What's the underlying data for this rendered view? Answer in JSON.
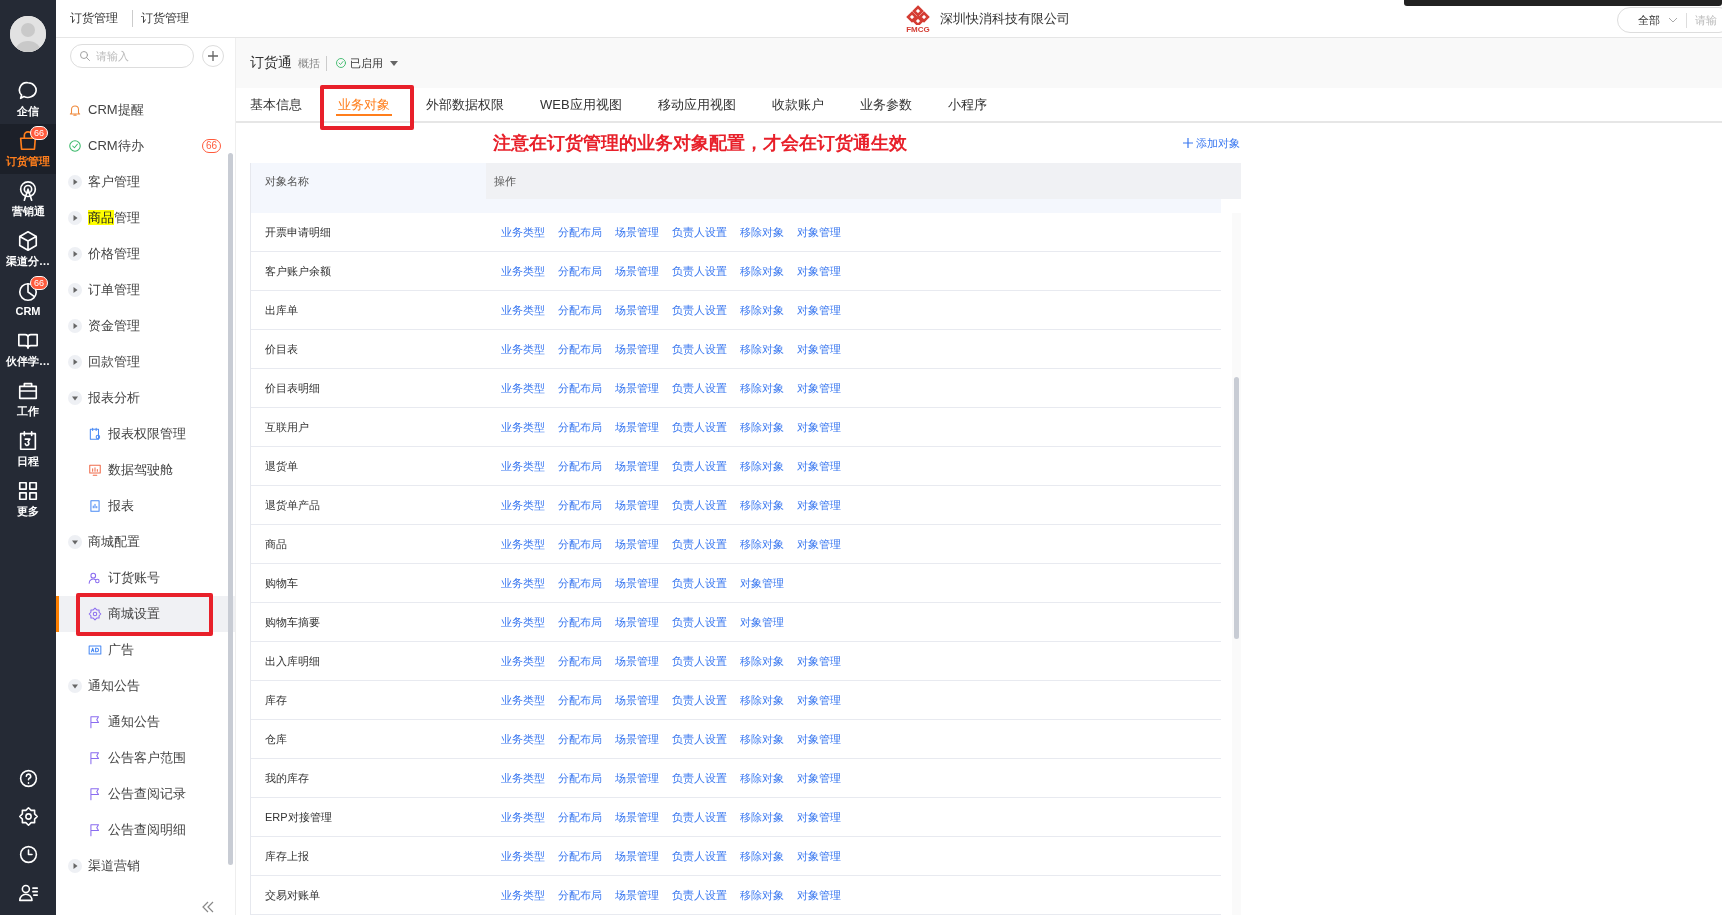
{
  "rail": {
    "items": [
      {
        "label": "企信",
        "selected": false
      },
      {
        "label": "订货管理",
        "selected": true,
        "badge": "66"
      },
      {
        "label": "营销通",
        "selected": false
      },
      {
        "label": "渠道分…",
        "selected": false
      },
      {
        "label": "CRM",
        "selected": false,
        "badge": "66"
      },
      {
        "label": "伙伴学…",
        "selected": false
      },
      {
        "label": "工作",
        "selected": false
      },
      {
        "label": "日程",
        "selected": false
      },
      {
        "label": "更多",
        "selected": false
      }
    ]
  },
  "topbar": {
    "breadcrumb": [
      "订货管理",
      "订货管理"
    ],
    "logo_text": "FMCG",
    "company": "深圳快消科技有限公司",
    "search_scope": "全部",
    "search_placeholder": "请输"
  },
  "sidebar": {
    "search_placeholder": "请输入",
    "items": [
      {
        "label": "CRM提醒",
        "selected": false
      },
      {
        "label": "CRM待办",
        "selected": false,
        "badge": "66"
      },
      {
        "label": "客户管理",
        "expanded": false
      },
      {
        "label_highlight": "商品",
        "label": "管理",
        "expanded": false
      },
      {
        "label": "价格管理",
        "expanded": false
      },
      {
        "label": "订单管理",
        "expanded": false
      },
      {
        "label": "资金管理",
        "expanded": false
      },
      {
        "label": "回款管理",
        "expanded": false
      },
      {
        "label": "报表分析",
        "expanded": true,
        "children": [
          {
            "label": "报表权限管理",
            "selected": false
          },
          {
            "label": "数据驾驶舱",
            "selected": false
          },
          {
            "label": "报表",
            "selected": false
          }
        ]
      },
      {
        "label": "商城配置",
        "expanded": true,
        "children": [
          {
            "label": "订货账号",
            "selected": false
          },
          {
            "label": "商城设置",
            "selected": true,
            "annotated": true
          },
          {
            "label": "广告",
            "selected": false
          }
        ]
      },
      {
        "label": "通知公告",
        "expanded": true,
        "children": [
          {
            "label": "通知公告",
            "selected": false
          },
          {
            "label": "公告客户范围",
            "selected": false
          },
          {
            "label": "公告查阅记录",
            "selected": false
          },
          {
            "label": "公告查阅明细",
            "selected": false
          }
        ]
      },
      {
        "label": "渠道营销",
        "expanded": false
      }
    ]
  },
  "header": {
    "title": "订货通",
    "subtitle": "概括",
    "status": "已启用"
  },
  "tabs": [
    {
      "label": "基本信息",
      "selected": false
    },
    {
      "label": "业务对象",
      "selected": true,
      "annotated": true
    },
    {
      "label": "外部数据权限",
      "selected": false
    },
    {
      "label": "WEB应用视图",
      "selected": false
    },
    {
      "label": "移动应用视图",
      "selected": false
    },
    {
      "label": "收款账户",
      "selected": false
    },
    {
      "label": "业务参数",
      "selected": false
    },
    {
      "label": "小程序",
      "selected": false
    }
  ],
  "note": "注意在订货管理的业务对象配置，才会在订货通生效",
  "add_button": "添加对象",
  "table": {
    "columns": [
      "对象名称",
      "操作"
    ],
    "rows": [
      {
        "name": "开票申请明细",
        "actions": [
          "业务类型",
          "分配布局",
          "场景管理",
          "负责人设置",
          "移除对象",
          "对象管理"
        ]
      },
      {
        "name": "客户账户余额",
        "actions": [
          "业务类型",
          "分配布局",
          "场景管理",
          "负责人设置",
          "移除对象",
          "对象管理"
        ]
      },
      {
        "name": "出库单",
        "actions": [
          "业务类型",
          "分配布局",
          "场景管理",
          "负责人设置",
          "移除对象",
          "对象管理"
        ]
      },
      {
        "name": "价目表",
        "actions": [
          "业务类型",
          "分配布局",
          "场景管理",
          "负责人设置",
          "移除对象",
          "对象管理"
        ]
      },
      {
        "name": "价目表明细",
        "actions": [
          "业务类型",
          "分配布局",
          "场景管理",
          "负责人设置",
          "移除对象",
          "对象管理"
        ]
      },
      {
        "name": "互联用户",
        "actions": [
          "业务类型",
          "分配布局",
          "场景管理",
          "负责人设置",
          "移除对象",
          "对象管理"
        ]
      },
      {
        "name": "退货单",
        "actions": [
          "业务类型",
          "分配布局",
          "场景管理",
          "负责人设置",
          "移除对象",
          "对象管理"
        ]
      },
      {
        "name": "退货单产品",
        "actions": [
          "业务类型",
          "分配布局",
          "场景管理",
          "负责人设置",
          "移除对象",
          "对象管理"
        ]
      },
      {
        "name": "商品",
        "actions": [
          "业务类型",
          "分配布局",
          "场景管理",
          "负责人设置",
          "移除对象",
          "对象管理"
        ]
      },
      {
        "name": "购物车",
        "actions": [
          "业务类型",
          "分配布局",
          "场景管理",
          "负责人设置",
          "对象管理"
        ]
      },
      {
        "name": "购物车摘要",
        "actions": [
          "业务类型",
          "分配布局",
          "场景管理",
          "负责人设置",
          "对象管理"
        ]
      },
      {
        "name": "出入库明细",
        "actions": [
          "业务类型",
          "分配布局",
          "场景管理",
          "负责人设置",
          "移除对象",
          "对象管理"
        ]
      },
      {
        "name": "库存",
        "actions": [
          "业务类型",
          "分配布局",
          "场景管理",
          "负责人设置",
          "移除对象",
          "对象管理"
        ]
      },
      {
        "name": "仓库",
        "actions": [
          "业务类型",
          "分配布局",
          "场景管理",
          "负责人设置",
          "移除对象",
          "对象管理"
        ]
      },
      {
        "name": "我的库存",
        "actions": [
          "业务类型",
          "分配布局",
          "场景管理",
          "负责人设置",
          "移除对象",
          "对象管理"
        ]
      },
      {
        "name": "ERP对接管理",
        "actions": [
          "业务类型",
          "分配布局",
          "场景管理",
          "负责人设置",
          "移除对象",
          "对象管理"
        ]
      },
      {
        "name": "库存上报",
        "actions": [
          "业务类型",
          "分配布局",
          "场景管理",
          "负责人设置",
          "移除对象",
          "对象管理"
        ]
      },
      {
        "name": "交易对账单",
        "actions": [
          "业务类型",
          "分配布局",
          "场景管理",
          "负责人设置",
          "移除对象",
          "对象管理"
        ]
      }
    ]
  }
}
